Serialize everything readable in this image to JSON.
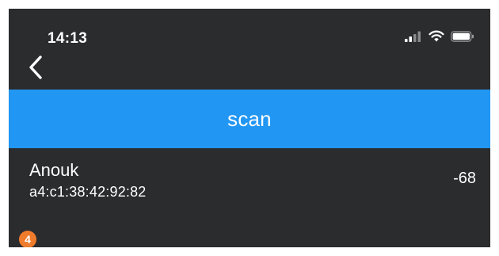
{
  "status_bar": {
    "time": "14:13",
    "icons": [
      "cellular-signal-icon",
      "wifi-icon",
      "battery-icon"
    ]
  },
  "nav": {
    "back_icon": "chevron-left-icon"
  },
  "scan_button": {
    "label": "scan",
    "color": "#2196f3"
  },
  "devices": [
    {
      "name": "Anouk",
      "address": "a4:c1:38:42:92:82",
      "rssi": "-68"
    }
  ],
  "step_badge": {
    "number": "4",
    "color": "#ef7b2c"
  },
  "colors": {
    "background": "#2b2c2e",
    "text": "#ffffff"
  }
}
